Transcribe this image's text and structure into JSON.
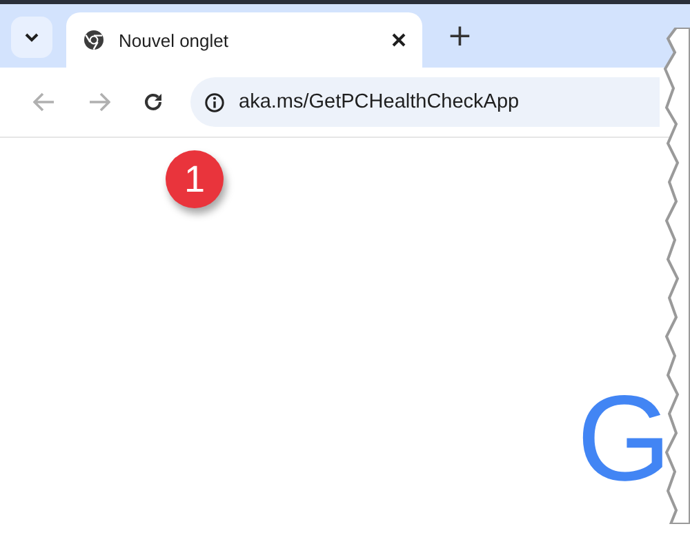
{
  "tabs": [
    {
      "title": "Nouvel onglet",
      "selected": true
    }
  ],
  "new_tab_button": "+",
  "address_bar": {
    "url": "aka.ms/GetPCHealthCheckApp"
  },
  "callout_badge": "1",
  "logo_fragment": "G"
}
